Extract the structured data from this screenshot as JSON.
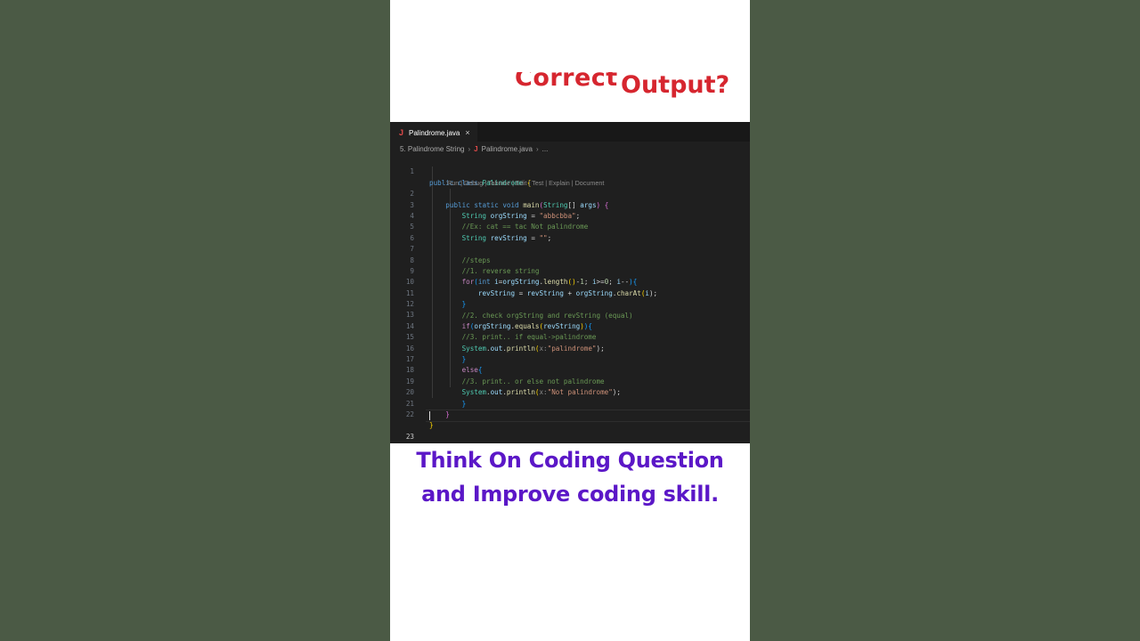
{
  "headline": {
    "word1": "Correct",
    "word2": "Output?"
  },
  "editor": {
    "tab": {
      "icon": "J",
      "name": "Palindrome.java",
      "close": "×"
    },
    "breadcrumb": {
      "folder": "5. Palindrome String",
      "file_icon": "J",
      "file": "Palindrome.java",
      "tail": "..."
    },
    "codelens": "Run | Debug | Tabnine | Edit | Test | Explain | Document",
    "line_numbers": [
      "1",
      "2",
      "3",
      "4",
      "5",
      "6",
      "7",
      "8",
      "9",
      "10",
      "11",
      "12",
      "13",
      "14",
      "15",
      "16",
      "17",
      "18",
      "19",
      "20",
      "21",
      "22",
      "23"
    ],
    "code": {
      "l1": [
        "public",
        "class",
        "Palindrome",
        "{"
      ],
      "l2": [
        "public",
        "static",
        "void",
        "main",
        "(",
        "String",
        "[]",
        "args",
        ")",
        "{"
      ],
      "l3": [
        "String",
        "orgString",
        "=",
        "\"abbcbba\"",
        ";"
      ],
      "l4": "//Ex: cat == tac Not palindrome",
      "l5": [
        "String",
        "revString",
        "=",
        "\"\"",
        ";"
      ],
      "l7": "//steps",
      "l8": "//1. reverse string",
      "l9": [
        "for",
        "(",
        "int",
        "i",
        "=",
        "orgString",
        ".",
        "length",
        "()",
        "-",
        "1",
        "; ",
        "i",
        ">=",
        "0",
        "; ",
        "i",
        "--",
        ")",
        "{"
      ],
      "l10": [
        "revString",
        "=",
        "revString",
        "+",
        "orgString",
        ".",
        "charAt",
        "(",
        "i",
        ");"
      ],
      "l11": "}",
      "l12": "//2. check orgString and revString (equal)",
      "l13": [
        "if",
        "(",
        "orgString",
        ".",
        "equals",
        "(",
        "revString",
        ")",
        ")",
        "{"
      ],
      "l14": "//3. print.. if equal->palindrome",
      "l15": [
        "System",
        ".",
        "out",
        ".",
        "println",
        "(",
        "x:",
        "\"palindrome\"",
        ");"
      ],
      "l16": "}",
      "l17": [
        "else",
        "{"
      ],
      "l18": "//3. print.. or else not palindrome",
      "l19": [
        "System",
        ".",
        "out",
        ".",
        "println",
        "(",
        "x:",
        "\"Not palindrome\"",
        ");"
      ],
      "l20": "}",
      "l21": "}",
      "l22": "}"
    }
  },
  "footer": {
    "line1": "Think On Coding Question",
    "line2": "and Improve coding skill."
  }
}
